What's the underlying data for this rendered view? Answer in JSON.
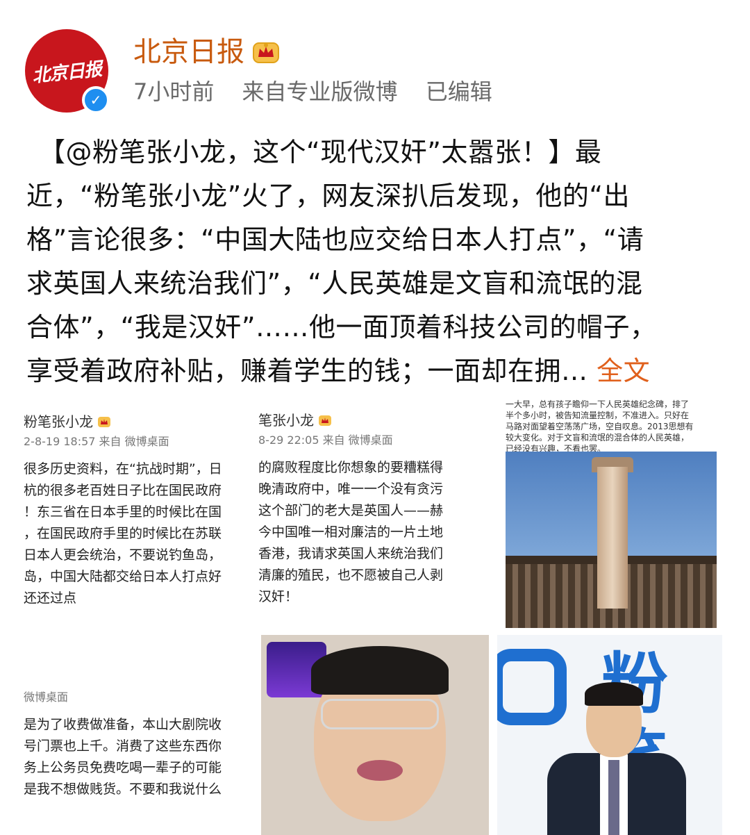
{
  "post": {
    "account_name": "北京日报",
    "avatar_text": "北京日报",
    "time": "7小时前",
    "source": "来自专业版微博",
    "edited": "已编辑",
    "text_lines": [
      "【@粉笔张小龙，这个“现代汉奸”太嚣张！】最",
      "近，“粉笔张小龙”火了，网友深扒后发现，他的“出",
      "格”言论很多：“中国大陆也应交给日本人打点”，“请",
      "求英国人来统治我们”，“人民英雄是文盲和流氓的混",
      "合体”，“我是汉奸”……他一面顶着科技公司的帽子，",
      "享受着政府补贴，赚着学生的钱；一面却在拥… "
    ],
    "full_text_link": "全文"
  },
  "images": {
    "img1": {
      "name": "粉笔张小龙",
      "meta": "2-8-19 18:57  来自 微博桌面",
      "lines": [
        "很多历史资料，在“抗战时期”，日",
        "杭的很多老百姓日子比在国民政府",
        "！东三省在日本手里的时候比在国",
        "，在国民政府手里的时候比在苏联",
        "日本人更会统治，不要说钓鱼岛，",
        "岛，中国大陆都交给日本人打点好",
        "还还过点"
      ]
    },
    "img2": {
      "name": "笔张小龙",
      "meta": "8-29 22:05  来自 微博桌面",
      "lines": [
        "的腐败程度比你想象的要糟糕得",
        "晚清政府中，唯一一个没有贪污",
        "这个部门的老大是英国人——赫",
        "今中国唯一相对廉洁的一片土地",
        "香港，我请求英国人来统治我们",
        "清廉的殖民，也不愿被自己人剥",
        "汉奸！"
      ]
    },
    "img3": {
      "lines": [
        "一大早，总有孩子瞻仰一下人民英雄纪念碑，排了",
        "半个多小时，被告知流量控制，不准进入。只好在",
        "马路对面望着空荡荡广场，空自叹息。2013思想有",
        "较大变化。对于文盲和流氓的混合体的人民英雄，",
        "已经没有兴趣，不看也罢。"
      ]
    },
    "img4": {
      "meta": "微博桌面",
      "lines": [
        "是为了收费做准备，本山大剧院收",
        "号门票也上千。消费了这些东西你",
        "务上公务员免费吃喝一辈子的可能",
        "是我不想做贱货。不要和我说什么"
      ]
    },
    "img6": {
      "logo_text": "粉笔"
    }
  },
  "colors": {
    "account_name": "#c85a0e",
    "link": "#e0601c",
    "avatar_bg": "#c8161d",
    "verify": "#1e8ef0",
    "underline": "#3aa58f"
  }
}
